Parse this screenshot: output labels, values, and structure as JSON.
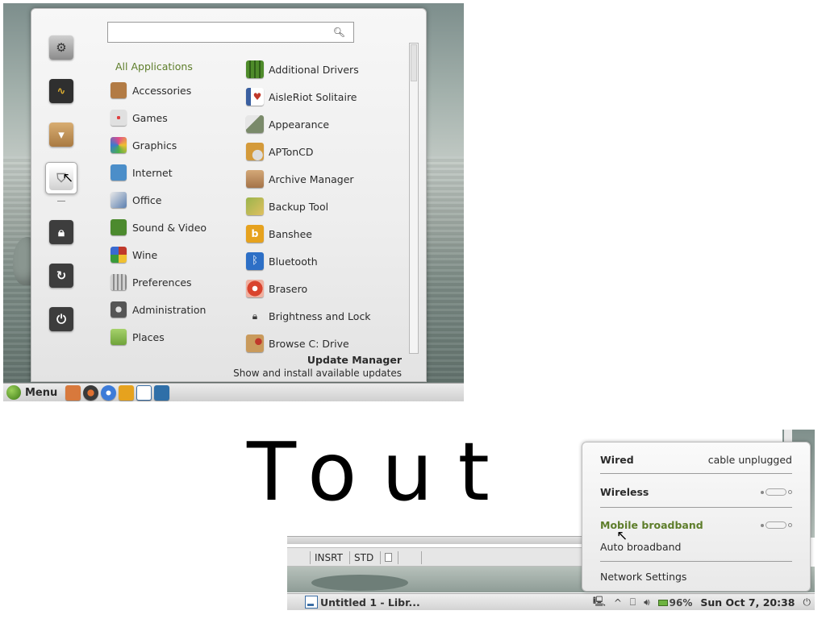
{
  "menu": {
    "search_placeholder": "",
    "search_value": "",
    "favorites": [
      {
        "name": "system-settings-icon",
        "color": "#8b8b8b"
      },
      {
        "name": "system-monitor-icon",
        "color": "#4a4a4a"
      },
      {
        "name": "software-manager-icon",
        "color": "#c99a5c"
      },
      {
        "name": "update-manager-shield-icon",
        "color": "#d9d9d9"
      },
      {
        "name": "lock-screen-icon",
        "color": "#3d3d3d"
      },
      {
        "name": "logout-icon",
        "color": "#3d3d3d"
      },
      {
        "name": "shutdown-icon",
        "color": "#3d3d3d"
      }
    ],
    "categories": [
      {
        "label": "All Applications",
        "color": ""
      },
      {
        "label": "Accessories",
        "color": "#b27b45"
      },
      {
        "label": "Games",
        "color": "#e0e0e0"
      },
      {
        "label": "Graphics",
        "color": "#e04a8a"
      },
      {
        "label": "Internet",
        "color": "#4b8ec9"
      },
      {
        "label": "Office",
        "color": "#5b7fb0"
      },
      {
        "label": "Sound & Video",
        "color": "#4c8a2e"
      },
      {
        "label": "Wine",
        "color": "#c0392b"
      },
      {
        "label": "Preferences",
        "color": "#9a9a9a"
      },
      {
        "label": "Administration",
        "color": "#555555"
      },
      {
        "label": "Places",
        "color": "#7fb24a"
      }
    ],
    "apps": [
      {
        "label": "Additional Drivers",
        "color": "#4e8b2a"
      },
      {
        "label": "AisleRiot Solitaire",
        "color": "#c0392b"
      },
      {
        "label": "Appearance",
        "color": "#7a8a6a"
      },
      {
        "label": "APTonCD",
        "color": "#d49a3a"
      },
      {
        "label": "Archive Manager",
        "color": "#b98555"
      },
      {
        "label": "Backup Tool",
        "color": "#9ab44c"
      },
      {
        "label": "Banshee",
        "color": "#e6a21e"
      },
      {
        "label": "Bluetooth",
        "color": "#2d6fc6"
      },
      {
        "label": "Brasero",
        "color": "#d9442e"
      },
      {
        "label": "Brightness and Lock",
        "color": "#3a3a3a"
      },
      {
        "label": "Browse C: Drive",
        "color": "#c99a5c"
      }
    ],
    "description": {
      "title": "Update Manager",
      "subtitle": "Show and install available updates"
    }
  },
  "panel1": {
    "menu_label": "Menu",
    "launchers": [
      {
        "name": "terminal-launcher-icon",
        "color": "#d8793c"
      },
      {
        "name": "browser-launcher-icon",
        "color": "#3a3a3a"
      },
      {
        "name": "media-launcher-icon",
        "color": "#3c7bd8"
      },
      {
        "name": "banshee-launcher-icon",
        "color": "#e6a21e"
      },
      {
        "name": "writer-launcher-icon",
        "color": "#3b6ea5"
      },
      {
        "name": "screenshot-launcher-icon",
        "color": "#2f6fa8"
      }
    ]
  },
  "big_text": "Tout",
  "libreoffice_status": {
    "insert_mode": "INSRT",
    "selection_mode": "STD"
  },
  "panel2": {
    "task_title": "Untitled 1 - Libr...",
    "battery": "96%",
    "clock": "Sun Oct  7, 20:38"
  },
  "network": {
    "wired_label": "Wired",
    "wired_status": "cable unplugged",
    "wireless_label": "Wireless",
    "mobile_label": "Mobile broadband",
    "auto_broadband": "Auto broadband",
    "settings": "Network Settings"
  }
}
